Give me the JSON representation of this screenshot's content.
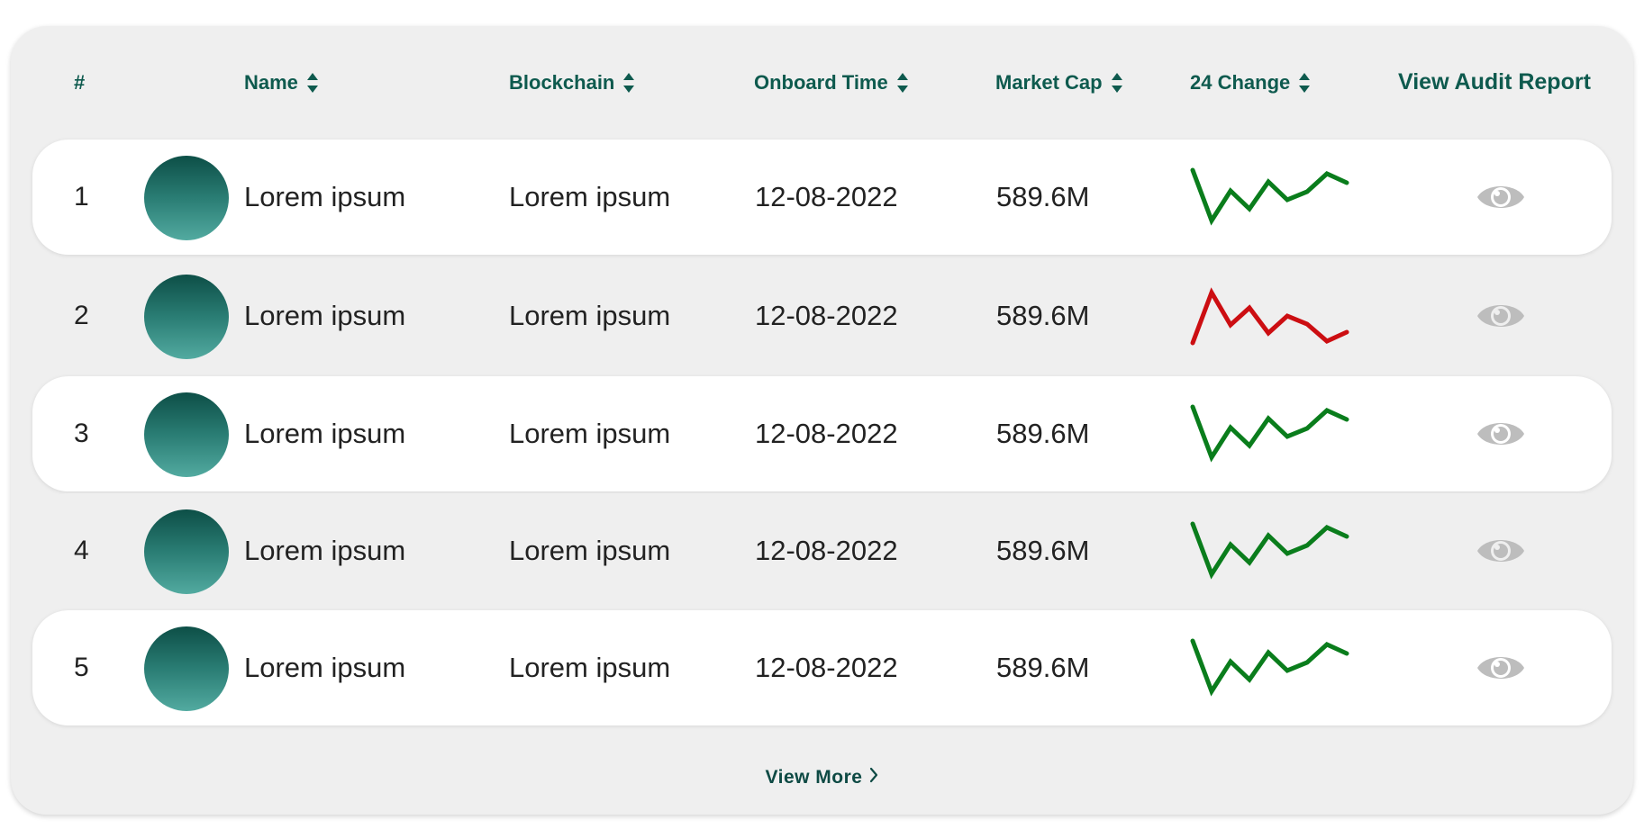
{
  "header": {
    "num": "#",
    "name": "Name",
    "blockchain": "Blockchain",
    "onboard_time": "Onboard Time",
    "market_cap": "Market Cap",
    "change_24": "24 Change",
    "audit": "View Audit Report"
  },
  "rows": [
    {
      "num": "1",
      "name": "Lorem ipsum",
      "blockchain": "Lorem ipsum",
      "onboard_time": "12-08-2022",
      "market_cap": "589.6M",
      "trend": "up"
    },
    {
      "num": "2",
      "name": "Lorem ipsum",
      "blockchain": "Lorem ipsum",
      "onboard_time": "12-08-2022",
      "market_cap": "589.6M",
      "trend": "down"
    },
    {
      "num": "3",
      "name": "Lorem ipsum",
      "blockchain": "Lorem ipsum",
      "onboard_time": "12-08-2022",
      "market_cap": "589.6M",
      "trend": "up"
    },
    {
      "num": "4",
      "name": "Lorem ipsum",
      "blockchain": "Lorem ipsum",
      "onboard_time": "12-08-2022",
      "market_cap": "589.6M",
      "trend": "up"
    },
    {
      "num": "5",
      "name": "Lorem ipsum",
      "blockchain": "Lorem ipsum",
      "onboard_time": "12-08-2022",
      "market_cap": "589.6M",
      "trend": "up"
    }
  ],
  "icons": {
    "sort": "sort-arrows-icon",
    "audit": "eye-icon",
    "more": "chevron-right-icon"
  },
  "colors": {
    "accent": "#0e5a4e",
    "trend_up": "#0a7d1c",
    "trend_down": "#cc0e12",
    "eye": "#bdbdbd"
  },
  "footer": {
    "view_more": "View More"
  }
}
